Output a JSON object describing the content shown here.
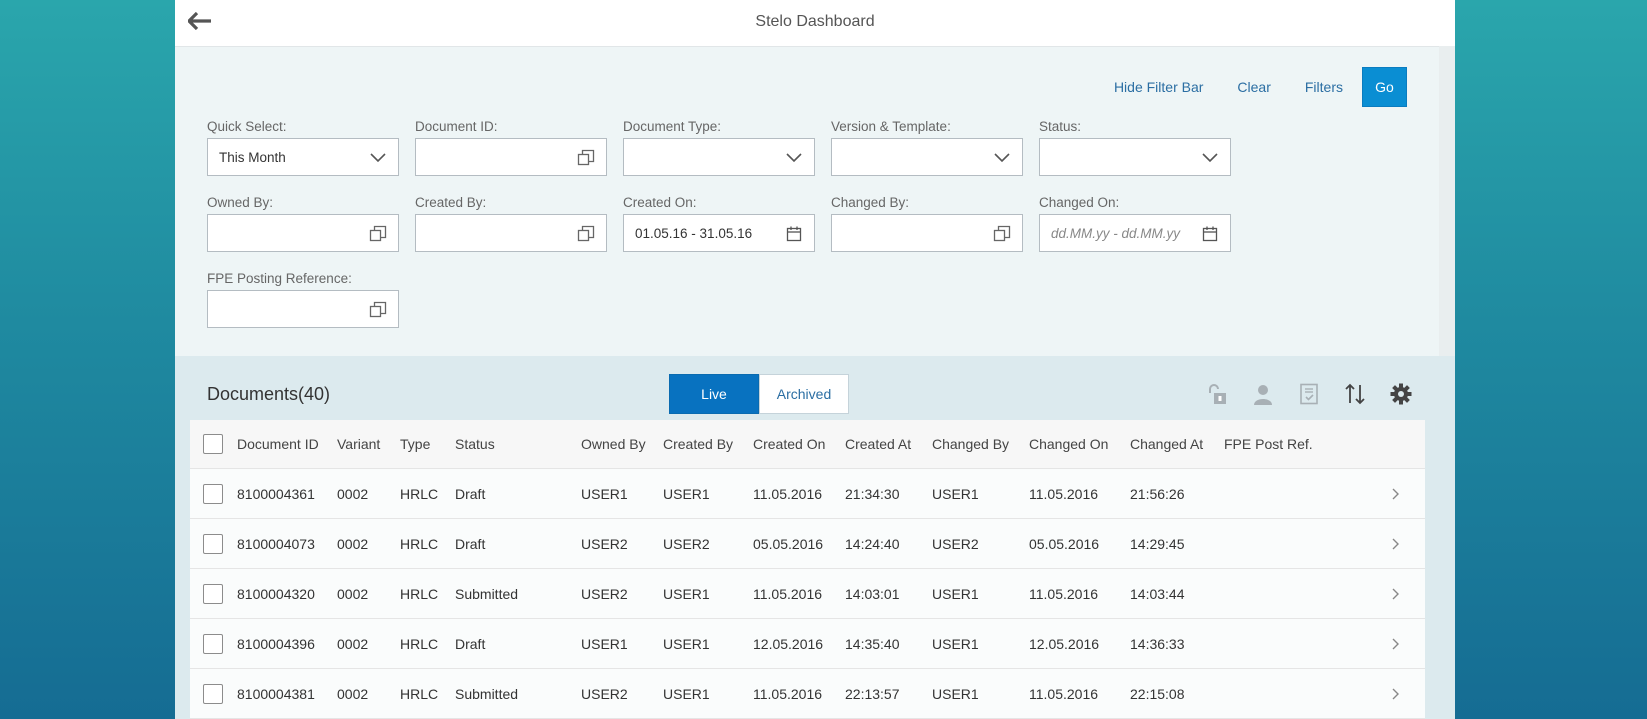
{
  "header": {
    "title": "Stelo Dashboard"
  },
  "filter_bar": {
    "actions": {
      "hide": "Hide Filter Bar",
      "clear": "Clear",
      "filters": "Filters",
      "go": "Go"
    },
    "fields": {
      "quick_select": {
        "label": "Quick Select:",
        "value": "This Month"
      },
      "document_id": {
        "label": "Document ID:",
        "value": ""
      },
      "document_type": {
        "label": "Document Type:",
        "value": ""
      },
      "version_template": {
        "label": "Version & Template:",
        "value": ""
      },
      "status": {
        "label": "Status:",
        "value": ""
      },
      "owned_by": {
        "label": "Owned By:",
        "value": ""
      },
      "created_by": {
        "label": "Created By:",
        "value": ""
      },
      "created_on": {
        "label": "Created On:",
        "value": "01.05.16 - 31.05.16"
      },
      "changed_by": {
        "label": "Changed By:",
        "value": ""
      },
      "changed_on": {
        "label": "Changed On:",
        "placeholder": "dd.MM.yy - dd.MM.yy"
      },
      "fpe_posting_reference": {
        "label": "FPE Posting Reference:",
        "value": ""
      }
    }
  },
  "documents": {
    "title": "Documents(40)",
    "tabs": {
      "live": "Live",
      "archived": "Archived"
    },
    "columns": {
      "document_id": "Document ID",
      "variant": "Variant",
      "type": "Type",
      "status": "Status",
      "owned_by": "Owned By",
      "created_by": "Created By",
      "created_on": "Created On",
      "created_at": "Created At",
      "changed_by": "Changed By",
      "changed_on": "Changed On",
      "changed_at": "Changed At",
      "fpe_post_ref": "FPE Post Ref."
    },
    "rows": [
      {
        "document_id": "8100004361",
        "variant": "0002",
        "type": "HRLC",
        "status": "Draft",
        "owned_by": "USER1",
        "created_by": "USER1",
        "created_on": "11.05.2016",
        "created_at": "21:34:30",
        "changed_by": "USER1",
        "changed_on": "11.05.2016",
        "changed_at": "21:56:26",
        "fpe_post_ref": ""
      },
      {
        "document_id": "8100004073",
        "variant": "0002",
        "type": "HRLC",
        "status": "Draft",
        "owned_by": "USER2",
        "created_by": "USER2",
        "created_on": "05.05.2016",
        "created_at": "14:24:40",
        "changed_by": "USER2",
        "changed_on": "05.05.2016",
        "changed_at": "14:29:45",
        "fpe_post_ref": ""
      },
      {
        "document_id": "8100004320",
        "variant": "0002",
        "type": "HRLC",
        "status": "Submitted",
        "owned_by": "USER2",
        "created_by": "USER1",
        "created_on": "11.05.2016",
        "created_at": "14:03:01",
        "changed_by": "USER1",
        "changed_on": "11.05.2016",
        "changed_at": "14:03:44",
        "fpe_post_ref": ""
      },
      {
        "document_id": "8100004396",
        "variant": "0002",
        "type": "HRLC",
        "status": "Draft",
        "owned_by": "USER1",
        "created_by": "USER1",
        "created_on": "12.05.2016",
        "created_at": "14:35:40",
        "changed_by": "USER1",
        "changed_on": "12.05.2016",
        "changed_at": "14:36:33",
        "fpe_post_ref": ""
      },
      {
        "document_id": "8100004381",
        "variant": "0002",
        "type": "HRLC",
        "status": "Submitted",
        "owned_by": "USER2",
        "created_by": "USER1",
        "created_on": "11.05.2016",
        "created_at": "22:13:57",
        "changed_by": "USER1",
        "changed_on": "11.05.2016",
        "changed_at": "22:15:08",
        "fpe_post_ref": ""
      }
    ]
  },
  "colors": {
    "accent": "#0a8ed3",
    "link": "#2b6ea3",
    "active_tab": "#0872c0"
  }
}
